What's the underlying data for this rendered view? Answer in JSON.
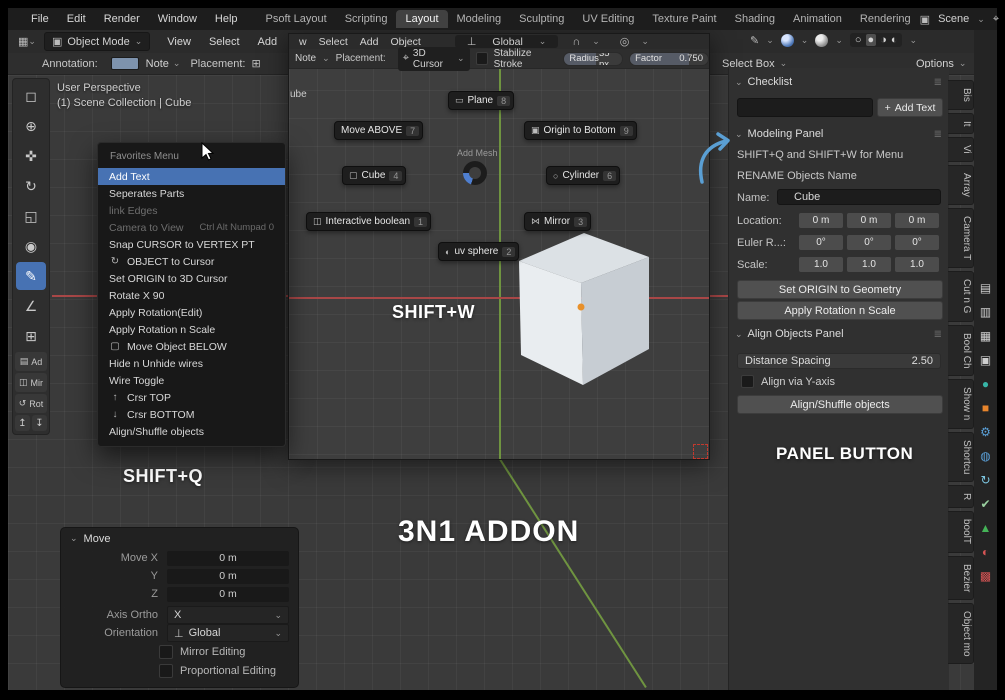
{
  "topbar": {
    "menus": [
      "File",
      "Edit",
      "Render",
      "Window",
      "Help"
    ],
    "workspaces": [
      "Psoft Layout",
      "Scripting",
      "Layout",
      "Modeling",
      "Sculpting",
      "UV Editing",
      "Texture Paint",
      "Shading",
      "Animation",
      "Rendering"
    ],
    "scene_label": "Scene"
  },
  "header": {
    "mode": "Object Mode",
    "menus": [
      "View",
      "Select",
      "Add",
      "Object"
    ],
    "select_tool": "Select Box",
    "options": "Options"
  },
  "tool_row": {
    "annotation_label": "Annotation:",
    "note": "Note",
    "placement_label": "Placement:"
  },
  "overlay": {
    "collection_fragment": "ube",
    "menus": [
      "w",
      "Select",
      "Add",
      "Object"
    ],
    "orientation": "Global",
    "note": "Note",
    "placement_label": "Placement:",
    "placement_value": "3D Cursor",
    "stabilize_label": "Stabilize Stroke",
    "radius_label": "Radius",
    "radius_value": "35 px",
    "factor_label": "Factor",
    "factor_value": "0.750"
  },
  "viewport": {
    "view_label": "User Perspective",
    "collection_label": "(1) Scene Collection | Cube"
  },
  "favorites": {
    "title": "Favorites Menu",
    "items": [
      {
        "label": "Add Text",
        "icon": ""
      },
      {
        "label": "Seperates Parts",
        "icon": ""
      },
      {
        "label": "link Edges",
        "icon": ""
      },
      {
        "label": "Camera to View",
        "shortcut": "Ctrl Alt Numpad 0",
        "icon": ""
      },
      {
        "label": "Snap CURSOR to VERTEX PT",
        "icon": ""
      },
      {
        "label": "OBJECT to Cursor",
        "icon": "↻"
      },
      {
        "label": "Set ORIGIN to 3D Cursor",
        "icon": ""
      },
      {
        "label": "Rotate X 90",
        "icon": ""
      },
      {
        "label": "Apply Rotation(Edit)",
        "icon": ""
      },
      {
        "label": "Apply Rotation n Scale",
        "icon": ""
      },
      {
        "label": "Move Object BELOW",
        "icon": "▢"
      },
      {
        "label": "Hide n Unhide wires",
        "icon": ""
      },
      {
        "label": "Wire Toggle",
        "icon": ""
      },
      {
        "label": "Crsr TOP",
        "icon": "↑"
      },
      {
        "label": "Crsr BOTTOM",
        "icon": "↓"
      },
      {
        "label": "Align/Shuffle objects",
        "icon": ""
      }
    ]
  },
  "pie": {
    "center_label": "Add Mesh",
    "items": [
      {
        "label": "Plane",
        "key": "8",
        "icon": "▭"
      },
      {
        "label": "Move ABOVE",
        "key": "7",
        "icon": ""
      },
      {
        "label": "Origin to Bottom",
        "key": "9",
        "icon": "▣"
      },
      {
        "label": "Cube",
        "key": "4",
        "icon": "▢"
      },
      {
        "label": "Cylinder",
        "key": "6",
        "icon": "○"
      },
      {
        "label": "Interactive boolean",
        "key": "1",
        "icon": "◫"
      },
      {
        "label": "Mirror",
        "key": "3",
        "icon": "⋈"
      },
      {
        "label": "uv sphere",
        "key": "2",
        "icon": "◐"
      }
    ]
  },
  "captions": {
    "shift_q": "SHIFT+Q",
    "shift_w": "SHIFT+W",
    "addon": "3N1 ADDON",
    "panel_button": "PANEL BUTTON"
  },
  "panel": {
    "checklist_title": "Checklist",
    "add_text_button": "Add Text",
    "modeling_title": "Modeling Panel",
    "hint1": "SHIFT+Q and SHIFT+W for Menu",
    "hint2": "RENAME Objects Name",
    "name_label": "Name:",
    "name_value": "Cube",
    "location_label": "Location:",
    "location_values": [
      "0 m",
      "0 m",
      "0 m"
    ],
    "euler_label": "Euler R...:",
    "euler_values": [
      "0°",
      "0°",
      "0°"
    ],
    "scale_label": "Scale:",
    "scale_values": [
      "1.0",
      "1.0",
      "1.0"
    ],
    "btn_origin": "Set ORIGIN to Geometry",
    "btn_apply": "Apply Rotation n Scale",
    "align_title": "Align Objects Panel",
    "distance_label": "Distance Spacing",
    "distance_value": "2.50",
    "align_y_label": "Align via Y-axis",
    "btn_shuffle": "Align/Shuffle objects"
  },
  "side_tabs": [
    "Bis",
    "It",
    "Vi",
    "Array",
    "Camera T",
    "Cut n G",
    "Bool Ch",
    "Show n",
    "Shortcu",
    "R",
    "boolT",
    "Bezier",
    "Object mo"
  ],
  "operator": {
    "title": "Move",
    "rows": [
      {
        "label": "Move X",
        "value": "0 m"
      },
      {
        "label": "Y",
        "value": "0 m"
      },
      {
        "label": "Z",
        "value": "0 m"
      }
    ],
    "axis_label": "Axis Ortho",
    "axis_value": "X",
    "orientation_label": "Orientation",
    "orientation_value": "Global",
    "mirror_label": "Mirror Editing",
    "proportional_label": "Proportional Editing"
  },
  "left_toolbar": {
    "ad": "Ad",
    "mir": "Mir",
    "rot": "Rot"
  }
}
